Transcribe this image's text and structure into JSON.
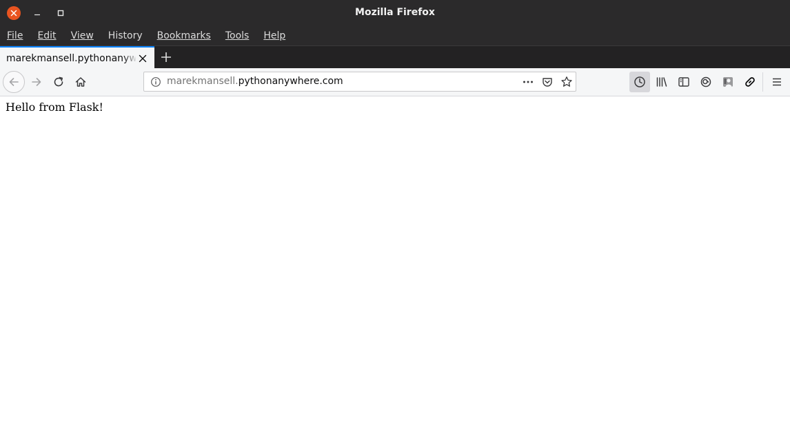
{
  "window": {
    "title": "Mozilla Firefox",
    "controls": [
      "close-icon",
      "minimize-icon",
      "maximize-icon"
    ]
  },
  "menubar": {
    "items": [
      {
        "label": "File"
      },
      {
        "label": "Edit"
      },
      {
        "label": "View"
      },
      {
        "label": "History"
      },
      {
        "label": "Bookmarks"
      },
      {
        "label": "Tools"
      },
      {
        "label": "Help"
      }
    ]
  },
  "tabs": {
    "active_title": "marekmansell.pythonanywhere.com"
  },
  "urlbar": {
    "domain_prefix": "marekmansell.",
    "domain_main": "pythonanywhere.com"
  },
  "page": {
    "text": "Hello from Flask!"
  },
  "colors": {
    "title_bar": "#2b2a2b",
    "close_button": "#e95420",
    "tab_accent": "#0a84ff",
    "toolbar": "#f5f6f7"
  }
}
